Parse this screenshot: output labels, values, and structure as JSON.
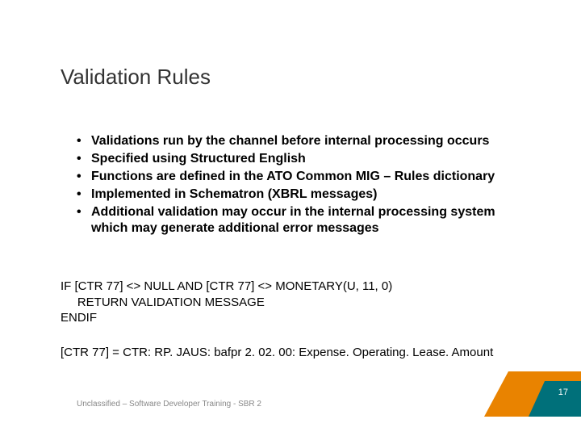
{
  "title": "Validation Rules",
  "bullets": [
    "Validations run by the channel before internal processing occurs",
    "Specified using Structured English",
    "Functions are defined in the ATO Common MIG – Rules dictionary",
    "Implemented in Schematron (XBRL messages)",
    "Additional validation may occur in the internal processing system which may generate additional error messages"
  ],
  "code": {
    "l1": "IF [CTR 77] <> NULL AND [CTR 77] <> MONETARY(U, 11, 0)",
    "l2": "     RETURN VALIDATION MESSAGE",
    "l3": "ENDIF"
  },
  "reference": "[CTR 77] = CTR: RP. JAUS: bafpr 2. 02. 00: Expense. Operating. Lease. Amount",
  "footer": "Unclassified – Software Developer Training - SBR 2",
  "page_number": "17",
  "colors": {
    "orange": "#e98300",
    "teal": "#00707a"
  }
}
